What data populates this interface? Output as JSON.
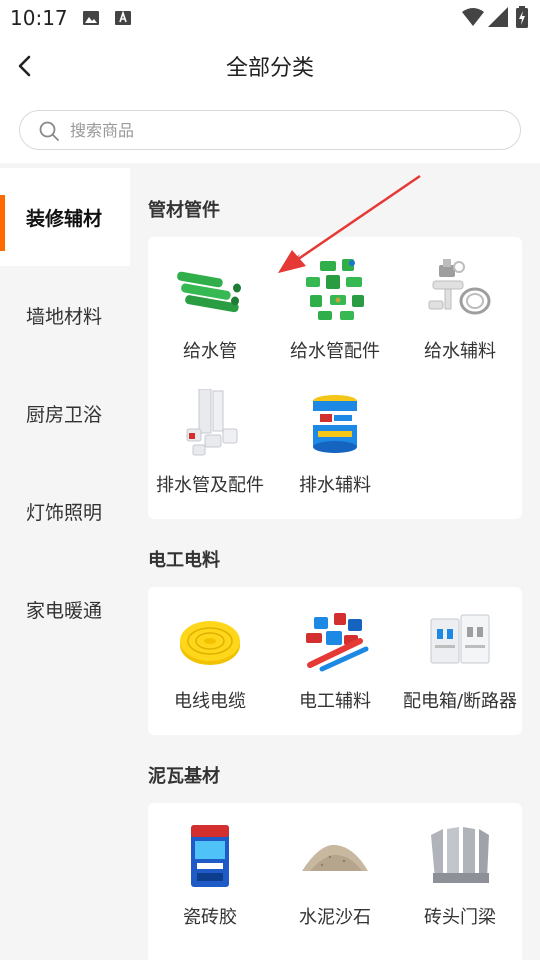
{
  "status": {
    "time": "10:17"
  },
  "nav": {
    "title": "全部分类"
  },
  "search": {
    "placeholder": "搜索商品"
  },
  "sidebar": {
    "items": [
      {
        "label": "装修辅材",
        "active": true
      },
      {
        "label": "墙地材料"
      },
      {
        "label": "厨房卫浴"
      },
      {
        "label": "灯饰照明"
      },
      {
        "label": "家电暖通"
      }
    ]
  },
  "sections": [
    {
      "title": "管材管件",
      "items": [
        {
          "label": "给水管",
          "icon": "green-pipes"
        },
        {
          "label": "给水管配件",
          "icon": "green-fittings"
        },
        {
          "label": "给水辅料",
          "icon": "faucet-hose"
        },
        {
          "label": "排水管及配件",
          "icon": "pvc-pipes"
        },
        {
          "label": "排水辅料",
          "icon": "glue-can"
        }
      ]
    },
    {
      "title": "电工电料",
      "items": [
        {
          "label": "电线电缆",
          "icon": "wire-coil"
        },
        {
          "label": "电工辅料",
          "icon": "conduit-fittings"
        },
        {
          "label": "配电箱/断路器",
          "icon": "breaker"
        }
      ]
    },
    {
      "title": "泥瓦基材",
      "items": [
        {
          "label": "瓷砖胶",
          "icon": "adhesive-bag"
        },
        {
          "label": "水泥沙石",
          "icon": "sand-pile"
        },
        {
          "label": "砖头门梁",
          "icon": "bricks"
        }
      ]
    }
  ],
  "colors": {
    "accent": "#ff6a00",
    "arrow": "#e53935",
    "pipe_green": "#2fae4a"
  }
}
